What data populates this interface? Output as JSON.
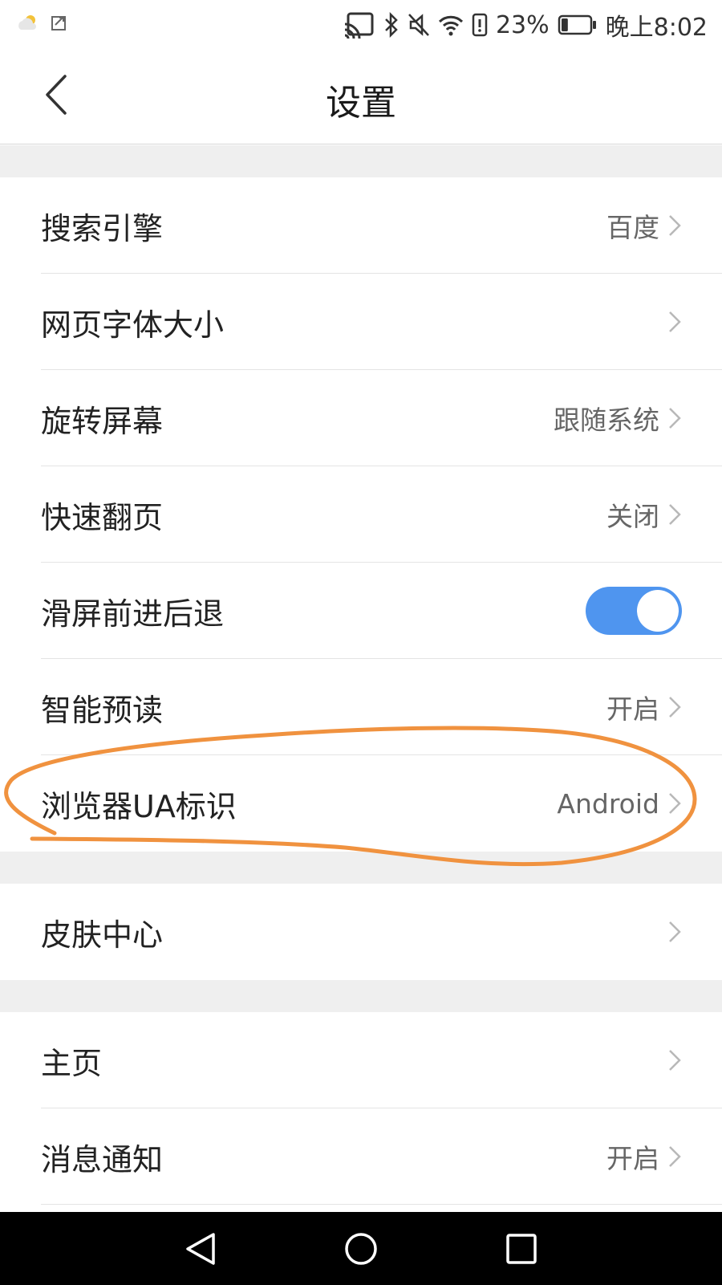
{
  "status_bar": {
    "battery_percent": "23%",
    "battery_level": 0.23,
    "time": "晚上8:02",
    "icons": [
      "weather-cloud-icon",
      "screenshot-icon",
      "cast-icon",
      "bluetooth-icon",
      "mute-icon",
      "wifi-icon",
      "alert-icon",
      "battery-icon"
    ]
  },
  "header": {
    "title": "设置",
    "back_icon": "back-chevron-icon"
  },
  "groups": [
    {
      "items": [
        {
          "label": "搜索引擎",
          "value": "百度"
        },
        {
          "label": "网页字体大小",
          "value": ""
        },
        {
          "label": "旋转屏幕",
          "value": "跟随系统"
        },
        {
          "label": "快速翻页",
          "value": "关闭"
        },
        {
          "label": "滑屏前进后退",
          "toggle": true
        },
        {
          "label": "智能预读",
          "value": "开启"
        },
        {
          "label": "浏览器UA标识",
          "value": "Android"
        }
      ]
    },
    {
      "items": [
        {
          "label": "皮肤中心",
          "value": ""
        }
      ]
    },
    {
      "items": [
        {
          "label": "主页",
          "value": ""
        },
        {
          "label": "消息通知",
          "value": "开启"
        }
      ]
    }
  ],
  "colors": {
    "toggle_on": "#4f95ef",
    "annotation": "#f0923f",
    "section_gap": "#efefef"
  }
}
